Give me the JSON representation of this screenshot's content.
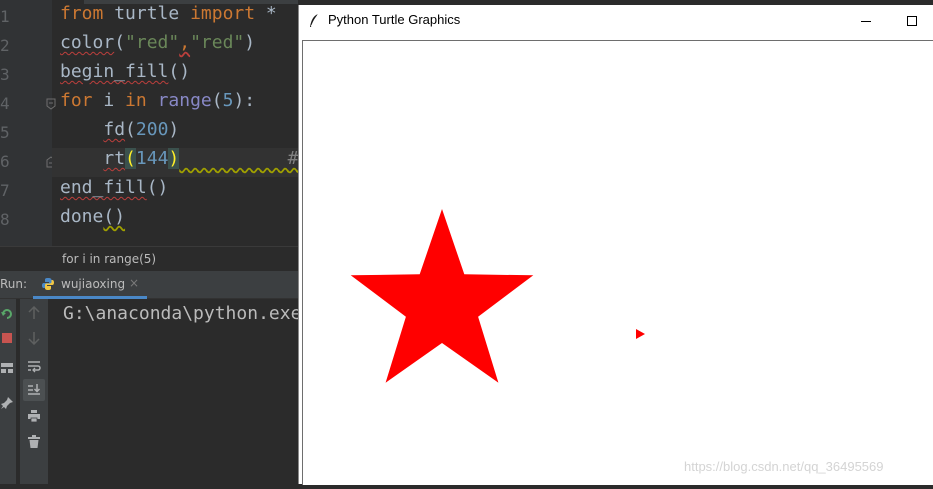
{
  "editor": {
    "line_numbers": [
      "1",
      "2",
      "3",
      "4",
      "5",
      "6",
      "7",
      "8"
    ],
    "lines": [
      {
        "t1": "from",
        "t2": " turtle ",
        "t3": "import",
        "t4": " *"
      },
      {
        "t1": "color",
        "t2": "(",
        "t3": "\"red\"",
        "t4": ",",
        "t5": "\"red\"",
        "t6": ")"
      },
      {
        "t1": "begin_fill",
        "t2": "()"
      },
      {
        "t1": "for",
        "t2": " i ",
        "t3": "in",
        "t4": " ",
        "t5": "range",
        "t6": "(",
        "t7": "5",
        "t8": "):"
      },
      {
        "t1": "    ",
        "t2": "fd",
        "t3": "(",
        "t4": "200",
        "t5": ")"
      },
      {
        "t1": "    ",
        "t2": "rt",
        "t3": "(",
        "t4": "144",
        "t5": ")",
        "t6": "          ##"
      },
      {
        "t1": "end_fill",
        "t2": "()"
      },
      {
        "t1": "done",
        "t2": "()"
      }
    ],
    "breadcrumb": "for i in range(5)"
  },
  "run": {
    "label": "Run:",
    "tab_name": "wujiaoxing",
    "tab_close": "×",
    "console_text": "G:\\anaconda\\python.exe",
    "tools_left": [
      "rerun-icon",
      "stop-icon",
      "layout-icon",
      "pin-icon"
    ],
    "tools_right": [
      "up-arrow-icon",
      "down-arrow-icon",
      "soft-wrap-icon",
      "scroll-to-end-icon",
      "print-icon",
      "trash-icon"
    ]
  },
  "turtle_window": {
    "title": "Python Turtle Graphics",
    "minimize_glyph": "—",
    "maximize_glyph": "☐",
    "star_color": "#ff0000",
    "watermark": "https://blog.csdn.net/qq_36495569"
  },
  "colors": {
    "keyword": "#cc7832",
    "string": "#6a8759",
    "number": "#6897bb",
    "ide_bg": "#2b2b2b"
  }
}
